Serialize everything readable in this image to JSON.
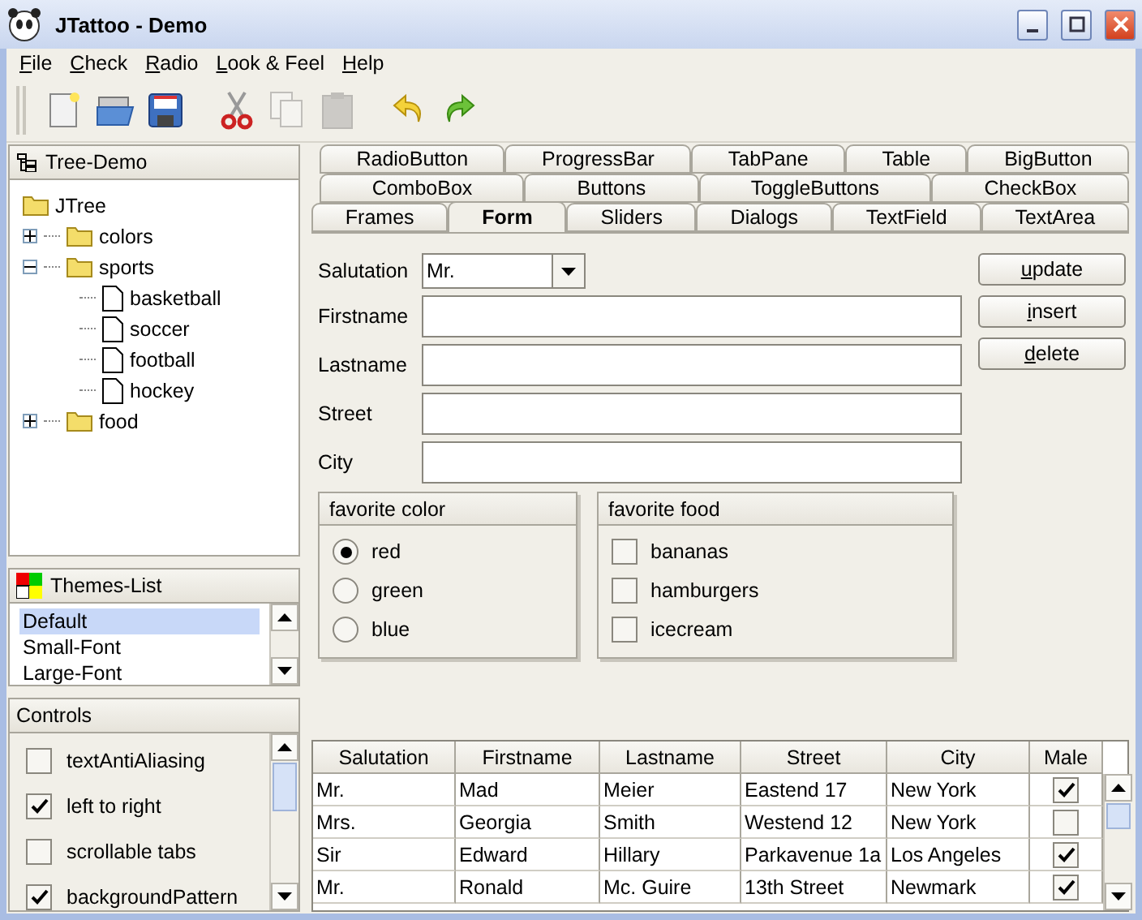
{
  "window": {
    "title": "JTattoo - Demo"
  },
  "menu": [
    {
      "key": "F",
      "rest": "ile"
    },
    {
      "key": "C",
      "rest": "heck"
    },
    {
      "key": "R",
      "rest": "adio"
    },
    {
      "key": "L",
      "rest": "ook & Feel"
    },
    {
      "key": "H",
      "rest": "elp"
    }
  ],
  "toolbar": [
    {
      "kind": "new",
      "disabled": false
    },
    {
      "kind": "open",
      "disabled": false
    },
    {
      "kind": "save",
      "disabled": false
    },
    {
      "kind": "cut",
      "disabled": false
    },
    {
      "kind": "copy",
      "disabled": true
    },
    {
      "kind": "paste",
      "disabled": true
    },
    {
      "kind": "undo",
      "disabled": false
    },
    {
      "kind": "redo",
      "disabled": false
    }
  ],
  "tree": {
    "title": "Tree-Demo",
    "root": {
      "label": "JTree",
      "kind": "folder",
      "children": [
        {
          "label": "colors",
          "kind": "folder",
          "expanded": false
        },
        {
          "label": "sports",
          "kind": "folder",
          "expanded": true,
          "children": [
            {
              "label": "basketball",
              "kind": "leaf"
            },
            {
              "label": "soccer",
              "kind": "leaf"
            },
            {
              "label": "football",
              "kind": "leaf"
            },
            {
              "label": "hockey",
              "kind": "leaf"
            }
          ]
        },
        {
          "label": "food",
          "kind": "folder",
          "expanded": false
        }
      ]
    }
  },
  "themes": {
    "title": "Themes-List",
    "items": [
      {
        "label": "Default",
        "selected": true
      },
      {
        "label": "Small-Font",
        "selected": false
      },
      {
        "label": "Large-Font",
        "selected": false
      }
    ]
  },
  "controls": {
    "title": "Controls",
    "items": [
      {
        "label": "textAntiAliasing",
        "checked": false
      },
      {
        "label": "left to right",
        "checked": true
      },
      {
        "label": "scrollable tabs",
        "checked": false
      },
      {
        "label": "backgroundPattern",
        "checked": true
      }
    ]
  },
  "tabs": [
    [
      {
        "label": "RadioButton",
        "selected": false
      },
      {
        "label": "ProgressBar",
        "selected": false
      },
      {
        "label": "TabPane",
        "selected": false
      },
      {
        "label": "Table",
        "selected": false
      },
      {
        "label": "BigButton",
        "selected": false
      }
    ],
    [
      {
        "label": "ComboBox",
        "selected": false
      },
      {
        "label": "Buttons",
        "selected": false
      },
      {
        "label": "ToggleButtons",
        "selected": false
      },
      {
        "label": "CheckBox",
        "selected": false
      }
    ],
    [
      {
        "label": "Frames",
        "selected": false
      },
      {
        "label": "Form",
        "selected": true
      },
      {
        "label": "Sliders",
        "selected": false
      },
      {
        "label": "Dialogs",
        "selected": false
      },
      {
        "label": "TextField",
        "selected": false
      },
      {
        "label": "TextArea",
        "selected": false
      }
    ]
  ],
  "form": {
    "salutation": {
      "label": "Salutation",
      "value": "Mr."
    },
    "fields": [
      {
        "label": "Firstname"
      },
      {
        "label": "Lastname"
      },
      {
        "label": "Street"
      },
      {
        "label": "City"
      }
    ],
    "buttons": [
      {
        "key": "u",
        "rest": "pdate"
      },
      {
        "key": "i",
        "rest": "nsert"
      },
      {
        "key": "d",
        "rest": "elete"
      }
    ],
    "color_group": {
      "title": "favorite color",
      "options": [
        {
          "label": "red",
          "selected": true
        },
        {
          "label": "green",
          "selected": false
        },
        {
          "label": "blue",
          "selected": false
        }
      ]
    },
    "food_group": {
      "title": "favorite food",
      "options": [
        {
          "label": "bananas",
          "checked": false
        },
        {
          "label": "hamburgers",
          "checked": false
        },
        {
          "label": "icecream",
          "checked": false
        }
      ]
    }
  },
  "table": {
    "columns": [
      "Salutation",
      "Firstname",
      "Lastname",
      "Street",
      "City",
      "Male"
    ],
    "rows": [
      {
        "cells": [
          "Mr.",
          "Mad",
          "Meier",
          "Eastend 17",
          "New York"
        ],
        "male": true
      },
      {
        "cells": [
          "Mrs.",
          "Georgia",
          "Smith",
          "Westend 12",
          "New York"
        ],
        "male": false
      },
      {
        "cells": [
          "Sir",
          "Edward",
          "Hillary",
          "Parkavenue 1a",
          "Los Angeles"
        ],
        "male": true
      },
      {
        "cells": [
          "Mr.",
          "Ronald",
          "Mc. Guire",
          "13th Street",
          "Newmark"
        ],
        "male": true
      }
    ]
  }
}
